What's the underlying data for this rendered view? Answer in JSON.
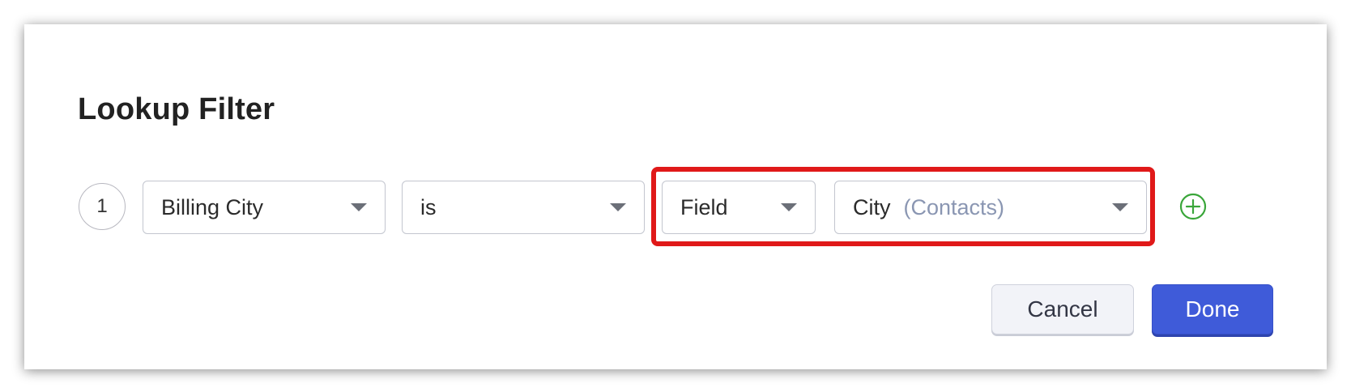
{
  "dialog": {
    "title": "Lookup Filter"
  },
  "filter_row": {
    "index": "1",
    "field": "Billing City",
    "operator": "is",
    "value_type": "Field",
    "value_field": "City",
    "value_module": "(Contacts)"
  },
  "actions": {
    "cancel_label": "Cancel",
    "done_label": "Done"
  },
  "icons": {
    "add": "plus-circle-icon",
    "dropdown": "caret-down-icon"
  },
  "colors": {
    "highlight": "#e01919",
    "primary": "#3f5bd9",
    "add_icon": "#3aa63a",
    "secondary_text": "#8a96b2"
  }
}
